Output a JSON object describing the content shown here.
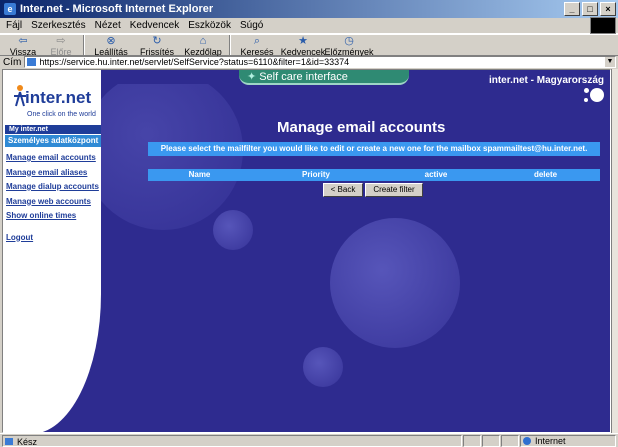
{
  "window": {
    "title": "Inter.net - Microsoft Internet Explorer",
    "ie_icon": "ie-icon",
    "controls": [
      "_",
      "□",
      "×"
    ]
  },
  "menu": [
    "Fájl",
    "Szerkesztés",
    "Nézet",
    "Kedvencek",
    "Eszközök",
    "Súgó"
  ],
  "toolbar": {
    "back": "Vissza",
    "forward": "Előre",
    "stop": "Leállítás",
    "refresh": "Frissítés",
    "home": "Kezdőlap",
    "search": "Keresés",
    "favorites": "Kedvencek",
    "history": "Előzmények"
  },
  "address": {
    "label": "Cím",
    "url": "https://service.hu.inter.net/servlet/SelfService?status=6110&filter=1&id=33374"
  },
  "page": {
    "banner": "Self care interface",
    "brand_right": "inter.net - Magyarország",
    "logo_text": "inter.net",
    "logo_tagline": "One click on the world",
    "my_inter": "My inter.net",
    "section": "Személyes adatközpont",
    "nav": [
      "Manage email accounts",
      "Manage email aliases",
      "Manage dialup accounts",
      "Manage web accounts",
      "Show online times",
      "Logout"
    ],
    "heading": "Manage email accounts",
    "info": "Please select the mailfilter you would like to edit or create a new one for the mailbox spammailtest@hu.inter.net.",
    "table_headers": [
      "Name",
      "Priority",
      "active",
      "delete"
    ],
    "back_button": "< Back",
    "create_button": "Create filter"
  },
  "status": {
    "text": "Kész",
    "zone": "Internet"
  },
  "colors": {
    "page_bg": "#2e2b8f",
    "accent": "#3a98f0",
    "banner": "#2f8a73",
    "nav_link": "#1f3d99"
  }
}
